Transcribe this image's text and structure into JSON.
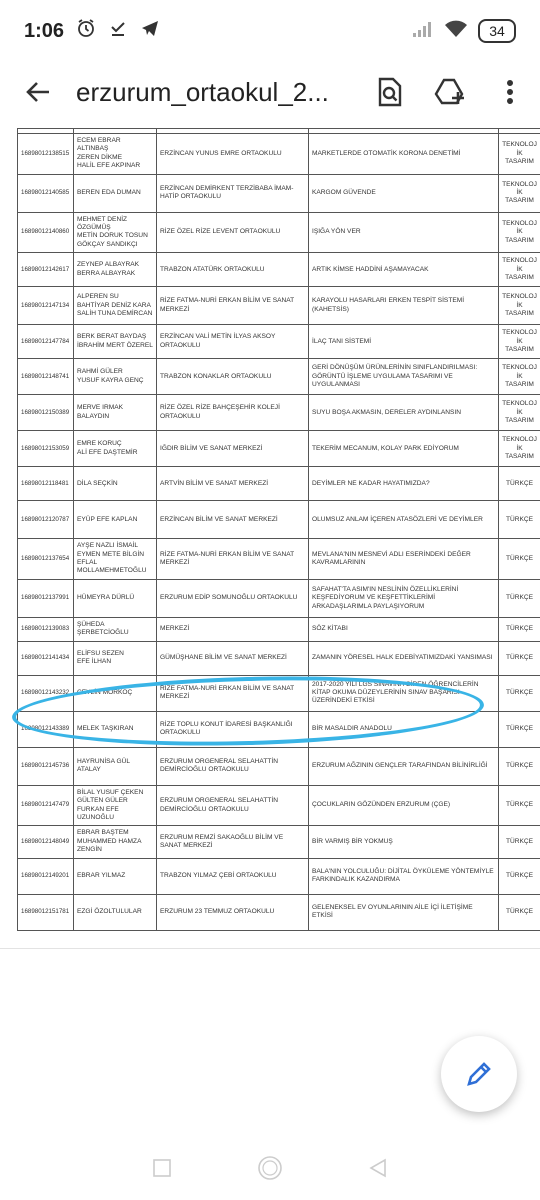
{
  "status_bar": {
    "time": "1:06",
    "battery": "34"
  },
  "app_bar": {
    "title": "erzurum_ortaokul_2..."
  },
  "table": {
    "rows": [
      {
        "id": "16898012138515",
        "students": "ECEM EBRAR ALTINBAŞ\nZEREN DİKME\nHALİL EFE AKPINAR",
        "school": "ERZİNCAN YUNUS EMRE ORTAOKULU",
        "project": "MARKETLERDE OTOMATİK KORONA DENETİMİ",
        "subject": "TEKNOLOJİK TASARIM"
      },
      {
        "id": "16898012140585",
        "students": "BEREN EDA DUMAN",
        "school": "ERZİNCAN DEMİRKENT TERZİBABA İMAM-HATİP ORTAOKULU",
        "project": "KARGOM GÜVENDE",
        "subject": "TEKNOLOJİK TASARIM"
      },
      {
        "id": "16898012140860",
        "students": "MEHMET DENİZ ÖZGÜMÜŞ\nMETİN DORUK TOSUN\nGÖKÇAY SANDIKÇI",
        "school": "RİZE ÖZEL RİZE LEVENT ORTAOKULU",
        "project": "IŞIĞA YÖN VER",
        "subject": "TEKNOLOJİK TASARIM"
      },
      {
        "id": "16898012142617",
        "students": "ZEYNEP ALBAYRAK\nBERRA ALBAYRAK",
        "school": "TRABZON ATATÜRK ORTAOKULU",
        "project": "ARTIK KİMSE HADDİNİ AŞAMAYACAK",
        "subject": "TEKNOLOJİK TASARIM"
      },
      {
        "id": "16898012147134",
        "students": "ALPEREN SU\nBAHTİYAR DENİZ KARA\nSALİH TUNA DEMİRCAN",
        "school": "RİZE FATMA-NURİ ERKAN BİLİM VE SANAT MERKEZİ",
        "project": "KARAYOLU HASARLARI ERKEN TESPİT SİSTEMİ (KAHETSİS)",
        "subject": "TEKNOLOJİK TASARIM"
      },
      {
        "id": "16898012147784",
        "students": "BERK BERAT BAYDAŞ\nİBRAHİM MERT ÖZEREL",
        "school": "ERZİNCAN VALİ METİN İLYAS AKSOY ORTAOKULU",
        "project": "İLAÇ TANI SİSTEMİ",
        "subject": "TEKNOLOJİK TASARIM"
      },
      {
        "id": "16898012148741",
        "students": "RAHMİ GÜLER\nYUSUF KAYRA GENÇ",
        "school": "TRABZON KONAKLAR ORTAOKULU",
        "project": "GERİ DÖNÜŞÜM ÜRÜNLERİNİN SINIFLANDIRILMASI: GÖRÜNTÜ İŞLEME UYGULAMA TASARIMI VE UYGULANMASI",
        "subject": "TEKNOLOJİK TASARIM"
      },
      {
        "id": "16898012150389",
        "students": "MERVE IRMAK BALAYDIN",
        "school": "RİZE ÖZEL RİZE BAHÇEŞEHİR KOLEJİ ORTAOKULU",
        "project": "SUYU BOŞA AKMASIN, DERELER AYDINLANSIN",
        "subject": "TEKNOLOJİK TASARIM"
      },
      {
        "id": "16898012153059",
        "students": "EMRE KORUÇ\nALİ EFE DAŞTEMİR",
        "school": "IĞDIR BİLİM VE SANAT MERKEZİ",
        "project": "TEKERİM MECANUM, KOLAY PARK EDİYORUM",
        "subject": "TEKNOLOJİK TASARIM"
      },
      {
        "id": "16898012118481",
        "students": "DİLA SEÇKİN",
        "school": "ARTVİN BİLİM VE SANAT MERKEZİ",
        "project": "DEYİMLER NE KADAR HAYATIMIZDA?",
        "subject": "TÜRKÇE"
      },
      {
        "id": "16898012120787",
        "students": "EYÜP EFE KAPLAN",
        "school": "ERZİNCAN BİLİM VE SANAT MERKEZİ",
        "project": "OLUMSUZ ANLAM İÇEREN ATASÖZLERİ VE DEYİMLER",
        "subject": "TÜRKÇE"
      },
      {
        "id": "16898012137654",
        "students": "AYŞE NAZLI İSMAİL\nEYMEN METE BİLGİN\nEFLAL\nMOLLAMEHMETOĞLU",
        "school": "RİZE FATMA-NURİ ERKAN BİLİM VE SANAT MERKEZİ",
        "project": "MEVLANA'NIN MESNEVİ ADLI ESERİNDEKİ DEĞER KAVRAMLARININ",
        "subject": "TÜRKÇE"
      },
      {
        "id": "16898012137991",
        "students": "HÜMEYRA DÜRLÜ",
        "school": "ERZURUM EDİP SOMUNOĞLU ORTAOKULU",
        "project": "SAFAHAT'TA ASIM'IN NESLİNİN ÖZELLİKLERİNİ KEŞFEDİYORUM VE KEŞFETTİKLERİMİ ARKADAŞLARIMLA PAYLAŞIYORUM",
        "subject": "TÜRKÇE"
      },
      {
        "id": "16898012139083",
        "students": "ŞÜHEDA ŞERBETCİOĞLU",
        "school": "MERKEZİ",
        "project": "SÖZ KİTABI",
        "subject": "TÜRKÇE"
      },
      {
        "id": "16898012141434",
        "students": "ELİFSU SEZEN\nEFE İLHAN",
        "school": "GÜMÜŞHANE BİLİM VE SANAT MERKEZİ",
        "project": "ZAMANIN YÖRESEL HALK EDEBİYATIMIZDAKİ YANSIMASI",
        "subject": "TÜRKÇE"
      },
      {
        "id": "16898012143232",
        "students": "CEYLİN MORKOÇ",
        "school": "RİZE FATMA-NURİ ERKAN BİLİM VE SANAT MERKEZİ",
        "project": "2017-2020 YILI LGS SINAVINA GİREN ÖĞRENCİLERİN KİTAP OKUMA DÜZEYLERİNİN SINAV BAŞARISI ÜZERİNDEKİ ETKİSİ",
        "subject": "TÜRKÇE"
      },
      {
        "id": "16898012143389",
        "students": "MELEK TAŞKIRAN",
        "school": "RİZE TOPLU KONUT İDARESİ BAŞKANLIĞI ORTAOKULU",
        "project": "BİR MASALDIR ANADOLU",
        "subject": "TÜRKÇE"
      },
      {
        "id": "16898012145736",
        "students": "HAYRUNİSA GÜL ATALAY",
        "school": "ERZURUM ORGENERAL SELAHATTİN DEMİRCİOĞLU ORTAOKULU",
        "project": "ERZURUM AĞZININ GENÇLER TARAFINDAN BİLİNİRLİĞİ",
        "subject": "TÜRKÇE"
      },
      {
        "id": "16898012147479",
        "students": "BİLAL YUSUF ÇEKEN\nGÜLTEN GÜLER\nFURKAN EFE UZUNOĞLU",
        "school": "ERZURUM ORGENERAL SELAHATTİN DEMİRCİOĞLU ORTAOKULU",
        "project": "ÇOCUKLARIN GÖZÜNDEN ERZURUM (ÇGE)",
        "subject": "TÜRKÇE"
      },
      {
        "id": "16898012148049",
        "students": "EBRAR BAŞTEM\nMUHAMMED HAMZA\nZENGİN",
        "school": "ERZURUM REMZİ SAKAOĞLU BİLİM VE SANAT MERKEZİ",
        "project": "BİR VARMIŞ BİR YOKMUŞ",
        "subject": "TÜRKÇE"
      },
      {
        "id": "16898012149201",
        "students": "EBRAR YILMAZ",
        "school": "TRABZON YILMAZ ÇEBİ ORTAOKULU",
        "project": "BALA'NIN YOLCULUĞU: DİJİTAL ÖYKÜLEME YÖNTEMİYLE FARKINDALIK KAZANDIRMA",
        "subject": "TÜRKÇE"
      },
      {
        "id": "16898012151781",
        "students": "EZGİ ÖZOLTULULAR",
        "school": "ERZURUM 23 TEMMUZ ORTAOKULU",
        "project": "GELENEKSEL EV OYUNLARININ AİLE İÇİ İLETİŞİME ETKİSİ",
        "subject": "TÜRKÇE"
      }
    ]
  },
  "icons": {
    "back": "arrow-left-icon",
    "search_doc": "search-document-icon",
    "drive_add": "add-to-drive-icon",
    "more": "more-vertical-icon",
    "edit": "edit-pencil-icon"
  },
  "colors": {
    "highlight": "#39b4e6",
    "fab_icon": "#2f6fd6"
  }
}
